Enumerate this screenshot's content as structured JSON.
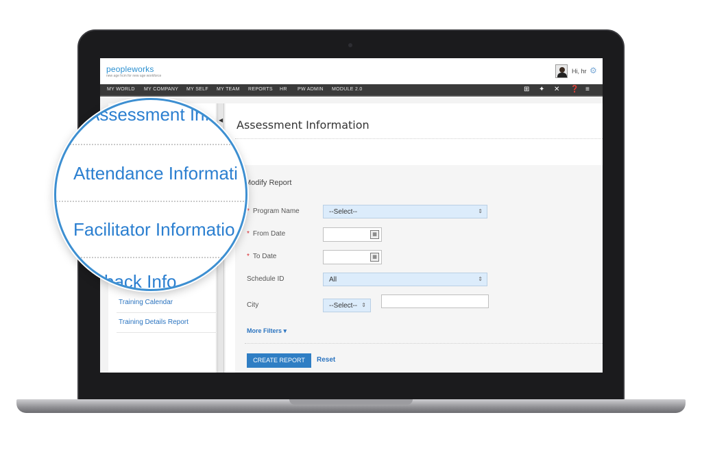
{
  "app": {
    "logo_text": "peopleworks",
    "tagline": "new age hcm for new age workforce",
    "greeting": "Hi, hr"
  },
  "nav": {
    "items": [
      "MY WORLD",
      "MY COMPANY",
      "MY SELF",
      "MY TEAM",
      "REPORTS",
      "HR",
      "PW ADMIN",
      "MODULE 2.0"
    ],
    "icons": [
      "book-icon",
      "pin-icon",
      "tools-icon",
      "help-icon",
      "menu-icon"
    ]
  },
  "sidebar": {
    "links": [
      "Training Calendar",
      "Training Details Report"
    ]
  },
  "magnifier": {
    "items": [
      "Assessment Info",
      "Attendance Informati",
      "Facilitator Informatio",
      "back Info"
    ]
  },
  "main": {
    "title": "Assessment Information",
    "section": "Modify Report",
    "fields": {
      "program_name": {
        "label": "Program Name",
        "value": "--Select--",
        "required": true
      },
      "from_date": {
        "label": "From Date",
        "required": true
      },
      "to_date": {
        "label": "To Date",
        "required": true
      },
      "schedule_id": {
        "label": "Schedule ID",
        "value": "All"
      },
      "city": {
        "label": "City",
        "value": "--Select--"
      }
    },
    "more_filters": "More Filters",
    "create_button": "CREATE REPORT",
    "reset_button": "Reset"
  },
  "colors": {
    "accent": "#2b7fd0",
    "nav_bg": "#3a3a3a",
    "button_bg": "#2f7ec4",
    "required": "#d9262c",
    "select_bg": "#dcecfb"
  }
}
